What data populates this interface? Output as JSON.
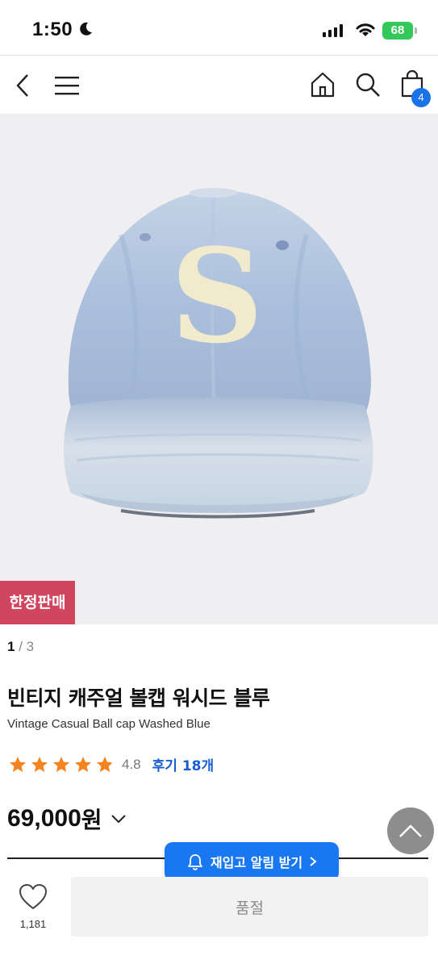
{
  "status_bar": {
    "time": "1:50",
    "battery": "68"
  },
  "nav": {
    "cart_count": "4",
    "icons": [
      "back-icon",
      "menu-icon",
      "home-icon",
      "search-icon",
      "cart-icon"
    ]
  },
  "product": {
    "tag": "한정판매",
    "pager_current": "1",
    "pager_total": "/ 3",
    "title_ko": "빈티지 캐주얼 볼캡 워시드 블루",
    "title_en": "Vintage Casual Ball cap Washed Blue",
    "rating": "4.8",
    "review_label": "후기 18개",
    "price": "69,000",
    "price_unit": "원"
  },
  "actions": {
    "restock_label": "재입고 알림 받기",
    "like_count": "1,181",
    "soldout_label": "품절"
  },
  "colors": {
    "accent_blue": "#1977f2",
    "tag_red": "#d0465e",
    "star": "#f5831f"
  }
}
